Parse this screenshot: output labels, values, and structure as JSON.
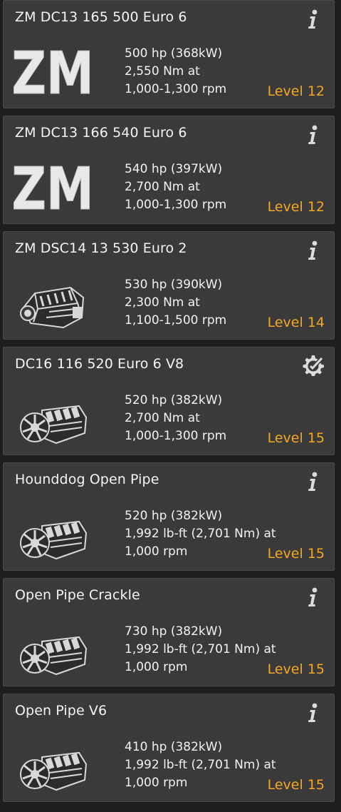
{
  "theme": {
    "card_bg": "#3a3a3a",
    "page_bg": "#1e1e1e",
    "level_color": "#f5a623",
    "text_color": "#f2f2f2",
    "icon_color": "#dcdcdc"
  },
  "engines": [
    {
      "name": "ZM DC13 165 500 Euro 6",
      "power": "500 hp (368kW)",
      "torque": "2,550 Nm at",
      "rpm": "1,000-1,300 rpm",
      "level_word": "Level",
      "level_num": "12",
      "image": "zm-logo",
      "logo_text": "ZM",
      "info_icon": "info-icon"
    },
    {
      "name": "ZM DC13 166 540 Euro 6",
      "power": "540 hp (397kW)",
      "torque": "2,700 Nm at",
      "rpm": "1,000-1,300 rpm",
      "level_word": "Level",
      "level_num": "12",
      "image": "zm-logo",
      "logo_text": "ZM",
      "info_icon": "info-icon"
    },
    {
      "name": "ZM DSC14 13 530 Euro 2",
      "power": "530 hp (390kW)",
      "torque": "2,300 Nm at",
      "rpm": "1,100-1,500 rpm",
      "level_word": "Level",
      "level_num": "14",
      "image": "inline-engine",
      "info_icon": "info-icon"
    },
    {
      "name": "DC16 116 520 Euro 6 V8",
      "power": "520 hp (382kW)",
      "torque": "2,700 Nm at",
      "rpm": "1,000-1,300 rpm",
      "level_word": "Level",
      "level_num": "15",
      "image": "v8-engine",
      "info_icon": "gear-check-icon"
    },
    {
      "name": "Hounddog Open Pipe",
      "power": "520 hp (382kW)",
      "torque": "1,992 lb-ft (2,701 Nm) at",
      "rpm": "1,000 rpm",
      "level_word": "Level",
      "level_num": "15",
      "image": "v8-engine",
      "info_icon": "info-icon"
    },
    {
      "name": "Open Pipe Crackle",
      "power": "730 hp (382kW)",
      "torque": "1,992 lb-ft (2,701 Nm) at",
      "rpm": "1,000 rpm",
      "level_word": "Level",
      "level_num": "15",
      "image": "v8-engine",
      "info_icon": "info-icon"
    },
    {
      "name": "Open Pipe V6",
      "power": "410 hp (382kW)",
      "torque": "1,992 lb-ft (2,701 Nm) at",
      "rpm": "1,000 rpm",
      "level_word": "Level",
      "level_num": "15",
      "image": "v8-engine",
      "info_icon": "info-icon"
    }
  ]
}
